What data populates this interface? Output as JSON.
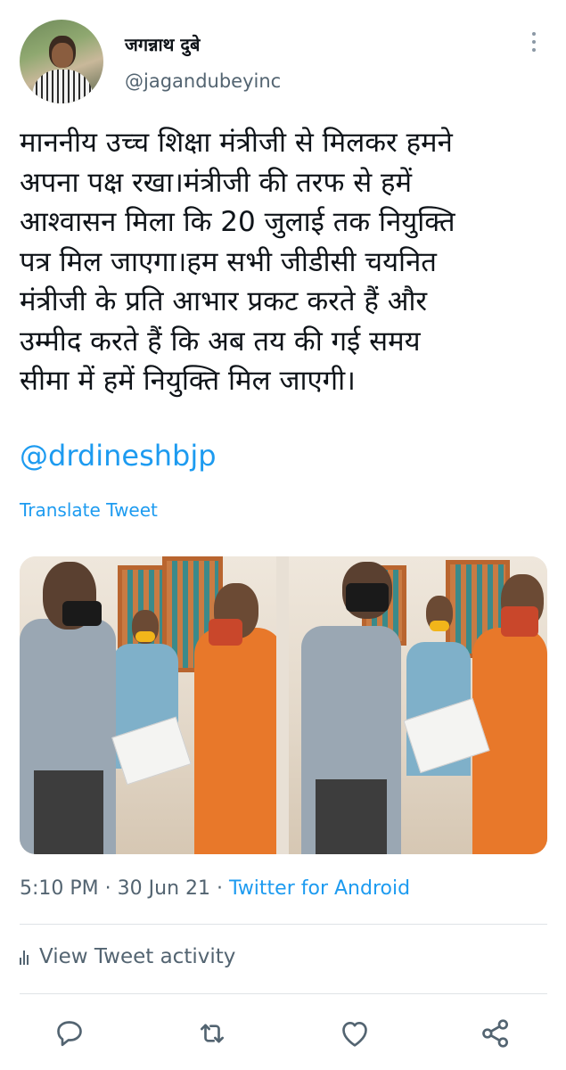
{
  "author": {
    "name": "जगन्नाथ दुबे",
    "handle": "@jagandubeyinc"
  },
  "tweet": {
    "text": "माननीय उच्च शिक्षा मंत्रीजी से मिलकर हमने\nअपना पक्ष रखा।मंत्रीजी की तरफ से हमें\nआश्वासन मिला कि 20 जुलाई तक नियुक्ति\nपत्र मिल जाएगा।हम सभी जीडीसी चयनित\nमंत्रीजी के प्रति आभार प्रकट करते हैं और\nउम्मीद करते हैं कि अब तय की गई समय\nसीमा में हमें नियुक्ति मिल जाएगी।",
    "mention": "@drdineshbjp",
    "translate_label": "Translate Tweet"
  },
  "meta": {
    "time": "5:10 PM",
    "separator": "·",
    "date": "30 Jun 21",
    "source": "Twitter for Android"
  },
  "activity": {
    "label": "View Tweet activity",
    "icon": "bar-chart-icon"
  },
  "actions": [
    {
      "name": "reply",
      "icon": "reply-icon"
    },
    {
      "name": "retweet",
      "icon": "retweet-icon"
    },
    {
      "name": "like",
      "icon": "heart-icon"
    },
    {
      "name": "share",
      "icon": "share-icon"
    }
  ],
  "colors": {
    "accent": "#1d9bf0",
    "secondary_text": "#536471",
    "primary_text": "#0f1419"
  }
}
